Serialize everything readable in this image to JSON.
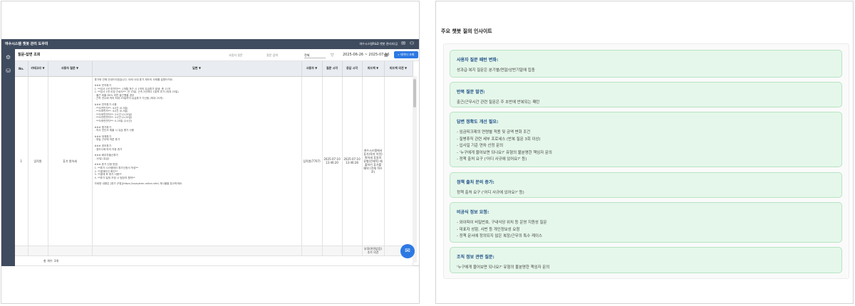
{
  "app": {
    "title": "여수시스템 챗봇 관리 도우미",
    "user": "여수시스템R&D 챗봇 관리자(김",
    "toolbar": {
      "title": "질문-답변 조회",
      "search_question_placeholder": "사용자 질문",
      "search_answer_placeholder": "질문 검색",
      "filter_select": "전체",
      "date_range": "2025-06-26 ~ 2025-07-10",
      "download_button": "데이터 조회"
    },
    "table": {
      "columns": [
        "No.",
        "카테고리 ▼",
        "사용자 질문 ▼",
        "답변 ▼",
        "사용자 ▼",
        "질문 시각",
        "응답 시각",
        "피드백 ▼",
        "피드백 의견 ▼"
      ],
      "rows": [
        {
          "no": "1",
          "category": "임직원",
          "question": "휴가 원하세",
          "user": "임직원(7707)",
          "asked": "2025-07-10 13:46:20",
          "answered": "2025-07-10 13:46:28",
          "feedback": "여수시스템에서 휴가(육아 이전) 원하세 휴일의 유형(전체적) 제출하기 휴가를 예약 (전체 적으로)",
          "feedback_comment": "",
          "answer_lines": [
            "휴가와 관해 안내드리겠습니다. 아래 사내 휴가 제도의 사례를 설명드려요.",
            "",
            "### 연차휴가",
            "1. **입사 1년 미만자**: 1개월 개근 시 1개의 유급휴가 발생, 총 11개",
            "2. **입사 1년 이상 근로자**: 연 15일, 근속 2년마다 1일씩 추가 (최대 25일)",
            "  - 출근 비율 80% 미만 출근했을 경우",
            "  - 근속 연수에 따라 최대 25일까지 유급휴가 가산됨 (최대 25개)",
            "",
            "### 반차휴가 사용",
            "- **오전반차**: 4시간 (0.5일)",
            "- **오후반차**: 4시간 (0.5일)",
            "- **오후반반차**: 2시간 (0.25일)",
            "- **오전반반차**: 2시간 (0.25일)",
            "- **오후반반차**: 0.25일 (2시간)",
            "",
            "### 병가휴가",
            "- 의사 진단서 제출 시 유급 병가 사용",
            "",
            "### 대체휴가",
            "- 휴일 근무에 따른 휴가",
            "",
            "### 경조휴가",
            "- 경조사에 따라 차등 휴가",
            "",
            "### 배우자출산휴가",
            "- 10일 (유급)",
            "",
            "### 휴가 신청 방법",
            "1. **휴가 시스템에서 휴가신청서 작성**",
            "2. **결재라인 확인**",
            "3. **결재 후 휴가 사용**",
            "4. **휴가 일정 조정 시 팀장과 협의**",
            "",
            "자세한 내용은 [휴가 규정](https://suaysten.roiton.site) 게시물을 참고하세요."
          ]
        }
      ],
      "sub_row_feedback": "부정(관련없음) 추가 의견",
      "footer": "총 개수: 3개"
    }
  },
  "insights": {
    "title": "주요 챗봇 질의 인사이트",
    "cards": [
      {
        "title": "사용자 질문 패턴 변화:",
        "lines": [
          "성과급·복지 질문은 분기별/연말/상반기말에 집중"
        ]
      },
      {
        "title": "반복 질문 발견:",
        "lines": [
          "출근/근무시간 관련 질문은 주 초반에 반복되는 패턴"
        ]
      },
      {
        "title": "답변 정확도 개선 필요:",
        "lines": [
          "- 임금피크제의 연령별 적용 및 금액 변화 조건",
          "- 질병휴직 관련 세부 프로세스 (반복 질문 3회 이상)",
          "- 입사일 기준 연차 산정 문의",
          "- '누구에게 물어보면 되나요?' 유형의 불분명한 책임자 문의",
          "- 정책 출처 요구 ('어디 사규에 있어요?' 등)"
        ]
      },
      {
        "title": "정책 출처 문의 증가:",
        "lines": [
          "정책 출처 요구 ('어디 사규에 있어요?' 등)"
        ]
      },
      {
        "title": "비공식 정보 요청:",
        "lines": [
          "- 와이파이 비밀번호, 구내식당 위치 등 운영 지원성 질문",
          "- 대표자 성함, 사번 등 개인정보성 요청",
          "- 정책 문서에 정의되지 않은 복장/근무의 특수 케이스"
        ]
      },
      {
        "title": "조직 정보 관련 질문:",
        "lines": [
          "'누구에게 물어보면 되나요?' 유형의 불분명한 책임자 문의"
        ]
      }
    ]
  },
  "icons": [
    "chat-icon",
    "user-icon",
    "settings-icon",
    "database-icon",
    "calendar-icon",
    "filter-icon",
    "search-icon"
  ]
}
